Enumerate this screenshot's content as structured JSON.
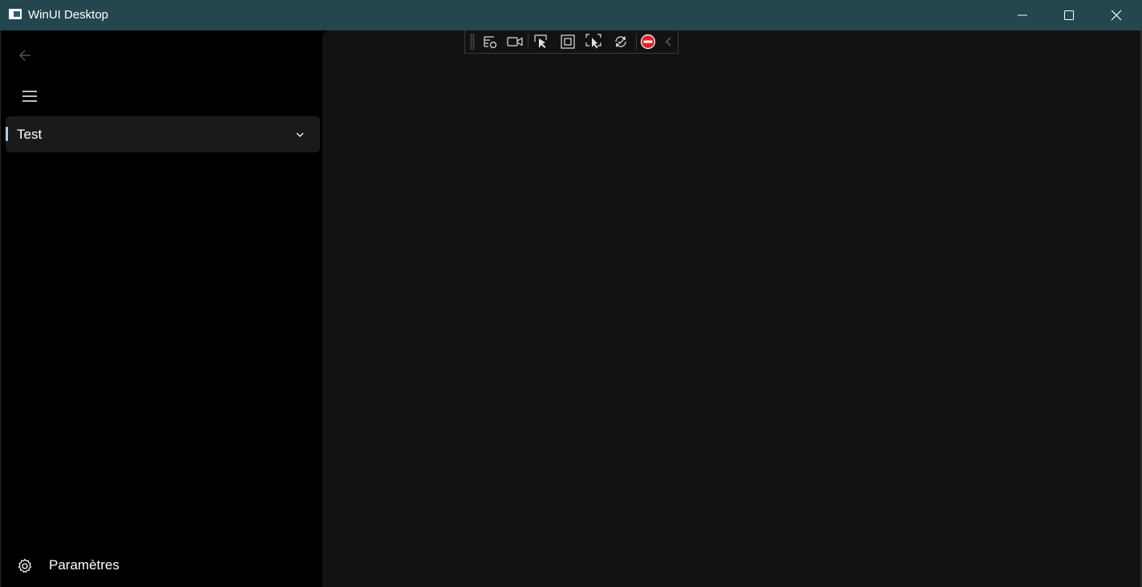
{
  "window": {
    "title": "WinUI Desktop"
  },
  "titlebar": {
    "icons": {
      "app": "app-window-icon",
      "minimize": "minimize-icon",
      "maximize": "maximize-icon",
      "close": "close-icon"
    }
  },
  "nav": {
    "back_icon": "arrow-left-icon",
    "menu_icon": "hamburger-icon",
    "items": [
      {
        "label": "Test",
        "selected": true,
        "icon": "chevron-down-icon"
      }
    ],
    "footer": {
      "settings_label": "Paramètres",
      "settings_icon": "gear-icon"
    }
  },
  "debug_toolbar": {
    "buttons": [
      "live-visual-tree-icon",
      "video-camera-icon",
      "select-element-icon",
      "display-layout-adorners-icon",
      "track-focus-icon",
      "hot-reload-icon",
      "stop-icon",
      "collapse-chevron-icon"
    ]
  },
  "colors": {
    "titlebar_bg": "#23464f",
    "nav_bg": "#000000",
    "content_bg": "#121212",
    "selected_item_bg": "#1a1a1a",
    "selection_indicator": "#9fd9e6",
    "stop_red": "#e0202b"
  }
}
